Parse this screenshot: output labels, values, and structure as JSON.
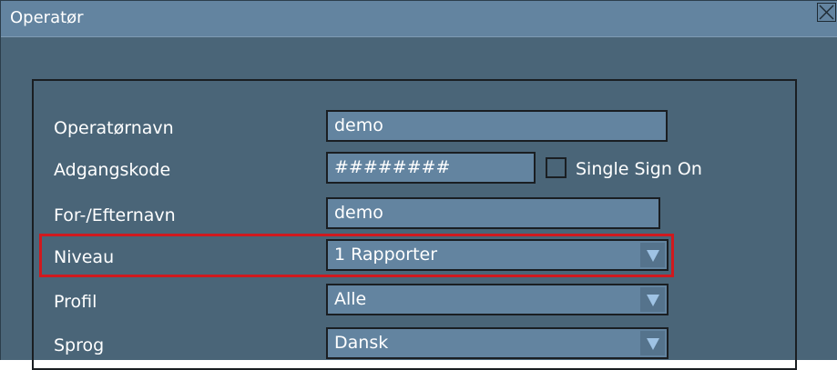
{
  "window": {
    "title": "Operatør"
  },
  "form": {
    "operator_name": {
      "label": "Operatørnavn",
      "value": "demo"
    },
    "password": {
      "label": "Adgangskode",
      "value": "########"
    },
    "single_sign_on": {
      "label": "Single Sign On",
      "checked": false
    },
    "full_name": {
      "label": "For-/Efternavn",
      "value": "demo"
    },
    "level": {
      "label": "Niveau",
      "value": "1 Rapporter"
    },
    "profile": {
      "label": "Profil",
      "value": "Alle"
    },
    "language": {
      "label": "Sprog",
      "value": "Dansk"
    }
  },
  "colors": {
    "window_bg": "#4a6578",
    "title_bar": "#6384a0",
    "field_bg": "#6384a0",
    "highlight": "#d0191e"
  },
  "icons": {
    "close": "close-icon",
    "dropdown": "triangle-down-icon"
  }
}
